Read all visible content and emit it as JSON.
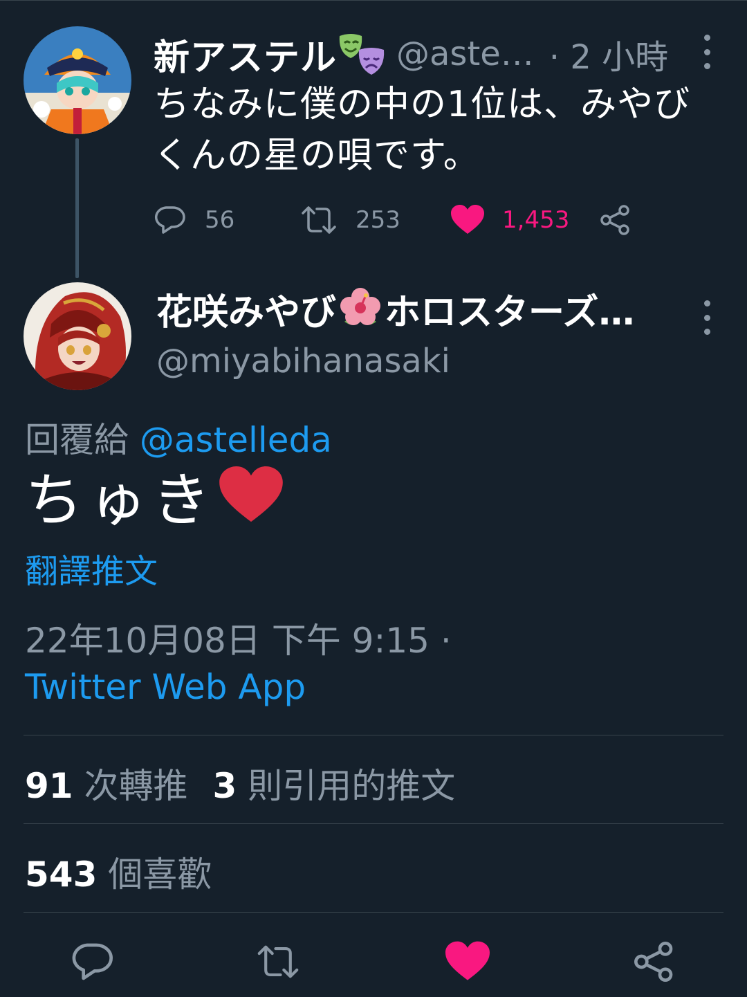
{
  "parent_tweet": {
    "display_name": "新アステル",
    "handle": "@aste…",
    "time": "· 2 小時",
    "text": "ちなみに僕の中の1位は、みやびくんの星の唄です。",
    "replies": "56",
    "retweets": "253",
    "likes": "1,453",
    "liked": true
  },
  "main_tweet": {
    "display_name": "花咲みやび",
    "display_name_suffix": "ホロスターズ…",
    "handle": "@miyabihanasaki",
    "reply_prefix": "回覆給",
    "reply_to": "@astelleda",
    "text": "ちゅき",
    "translate_label": "翻譯推文",
    "timestamp": "22年10月08日 下午 9:15 ·",
    "source": "Twitter Web App",
    "retweet_count": "91",
    "retweet_label": "次轉推",
    "quote_count": "3",
    "quote_label": "則引用的推文",
    "like_count": "543",
    "like_label": "個喜歡"
  },
  "icons": {
    "reply": "reply-icon",
    "retweet": "retweet-icon",
    "like": "heart-icon",
    "share": "share-icon",
    "more": "more-vertical-icon"
  },
  "colors": {
    "background": "#15202b",
    "secondary_text": "#8b98a5",
    "link": "#1d9bf0",
    "like": "#f91880",
    "divider": "#38444d"
  }
}
